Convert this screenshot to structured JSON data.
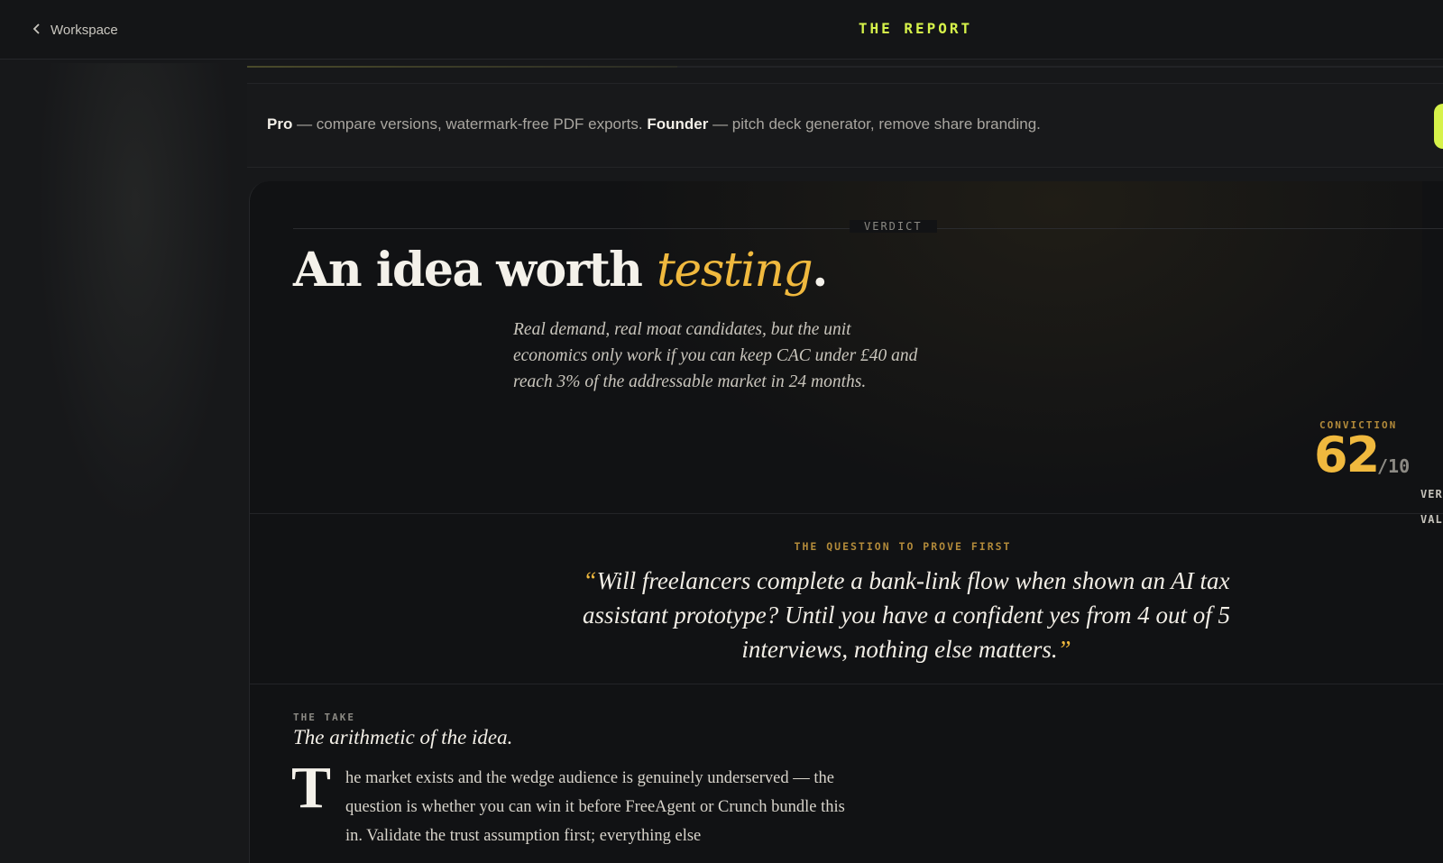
{
  "header": {
    "back_label": "Workspace",
    "title": "THE REPORT"
  },
  "upsell": {
    "pro_name": "Pro",
    "pro_text": " — compare versions, watermark-free PDF exports. ",
    "founder_name": "Founder",
    "founder_text": " — pitch deck generator, remove share branding."
  },
  "verdict": {
    "label": "VERDICT",
    "headline_main": "An idea worth ",
    "headline_accent": "testing",
    "headline_end": ".",
    "summary": "Real demand, real moat candidates, but the unit economics only work if you can keep CAC under £40 and reach 3% of the addressable market in 24 months.",
    "conviction_label": "CONVICTION",
    "conviction_score": "62",
    "conviction_max": "/10",
    "side_tag_1": "VER",
    "side_tag_2": "VALI"
  },
  "question": {
    "label": "THE QUESTION TO PROVE FIRST",
    "open_quote": "“",
    "text": "Will freelancers complete a bank-link flow when shown an AI tax assistant prototype? Until you have a confident yes from 4 out of 5 interviews, nothing else matters.",
    "close_quote": "”"
  },
  "take": {
    "label": "THE TAKE",
    "title": "The arithmetic of the idea.",
    "dropcap": "T",
    "body": "he market exists and the wedge audience is genuinely underserved — the question is whether you can win it before FreeAgent or Crunch bundle this in. Validate the trust assumption first; everything else"
  },
  "colors": {
    "accent_lime": "#d6f24a",
    "accent_gold": "#f0b93e",
    "background": "#17181a",
    "card": "#111214"
  }
}
